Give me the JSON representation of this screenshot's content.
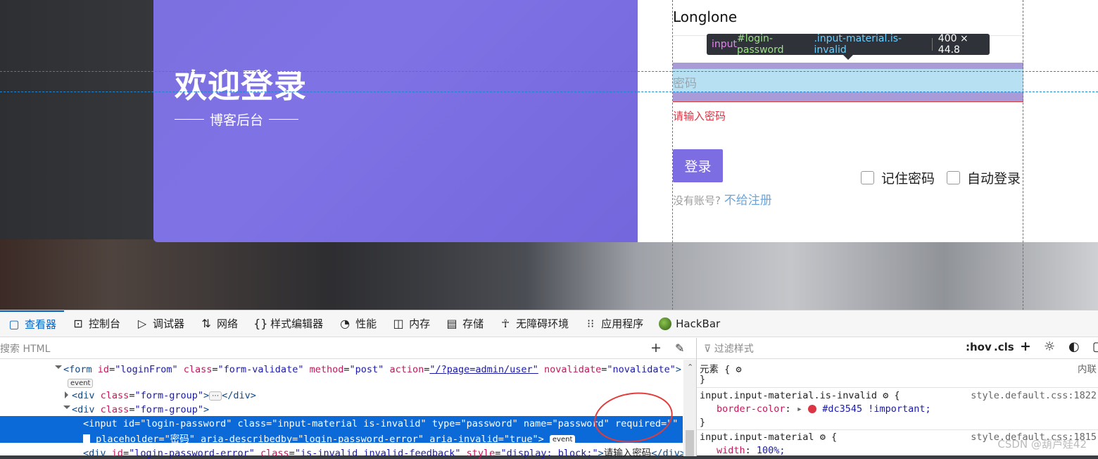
{
  "page": {
    "hero_title": "欢迎登录",
    "hero_subtitle": "博客后台",
    "brand": "Longlone",
    "password_placeholder": "密码",
    "password_error": "请输入密码",
    "login_button": "登录",
    "remember_label": "记住密码",
    "auto_login_label": "自动登录",
    "no_account_text": "没有账号?",
    "register_link": "不给注册"
  },
  "tooltip": {
    "tag": "input",
    "id": "#login-password",
    "classes": ".input-material.is-invalid",
    "size": "400 × 44.8"
  },
  "devtools": {
    "tabs": [
      {
        "label": "查看器",
        "icon": "inspector-icon"
      },
      {
        "label": "控制台",
        "icon": "console-icon"
      },
      {
        "label": "调试器",
        "icon": "debugger-icon"
      },
      {
        "label": "网络",
        "icon": "network-icon"
      },
      {
        "label": "样式编辑器",
        "icon": "style-editor-icon"
      },
      {
        "label": "性能",
        "icon": "performance-icon"
      },
      {
        "label": "内存",
        "icon": "memory-icon"
      },
      {
        "label": "存储",
        "icon": "storage-icon"
      },
      {
        "label": "无障碍环境",
        "icon": "accessibility-icon"
      },
      {
        "label": "应用程序",
        "icon": "application-icon"
      },
      {
        "label": "HackBar",
        "icon": "hackbar-icon"
      }
    ],
    "search_placeholder": "搜索 HTML",
    "filter_placeholder": "过滤样式",
    "hov": ":hov",
    "cls": ".cls",
    "html_lines": {
      "form_tag": "form",
      "form_id": "\"loginFrom\"",
      "form_class": "\"form-validate\"",
      "form_method": "\"post\"",
      "form_action": "\"/?page=admin/user\"",
      "form_novalidate": "\"novalidate\"",
      "event": "event",
      "div_tag": "div",
      "div_class": "\"form-group\"",
      "ellipsis": "⋯",
      "input_id": "\"login-password\"",
      "input_class": "\"input-material is-invalid\"",
      "input_type": "\"password\"",
      "input_name": "\"password\"",
      "input_required": "\"\"",
      "input_placeholder": "\"密码\"",
      "input_describedby": "\"login-password-error\"",
      "input_invalid": "\"true\"",
      "err_id": "\"login-password-error\"",
      "err_class": "\"is-invalid invalid-feedback\"",
      "err_style": "\"display: block;\"",
      "err_text": "请输入密码"
    },
    "rules": [
      {
        "selector": "元素",
        "source": "内联"
      },
      {
        "selector": "input.input-material.is-invalid",
        "source": "style.default.css:1822",
        "prop": "border-color",
        "value": "#dc3545 !important;"
      },
      {
        "selector": "input.input-material",
        "source": "style.default.css:1815",
        "prop": "width",
        "value": "100%;"
      }
    ]
  },
  "watermark": "CSDN @葫芦娃42",
  "colors": {
    "accent": "#7c6de3",
    "error": "#dc3545",
    "devtools_select": "#0c6ad8"
  }
}
